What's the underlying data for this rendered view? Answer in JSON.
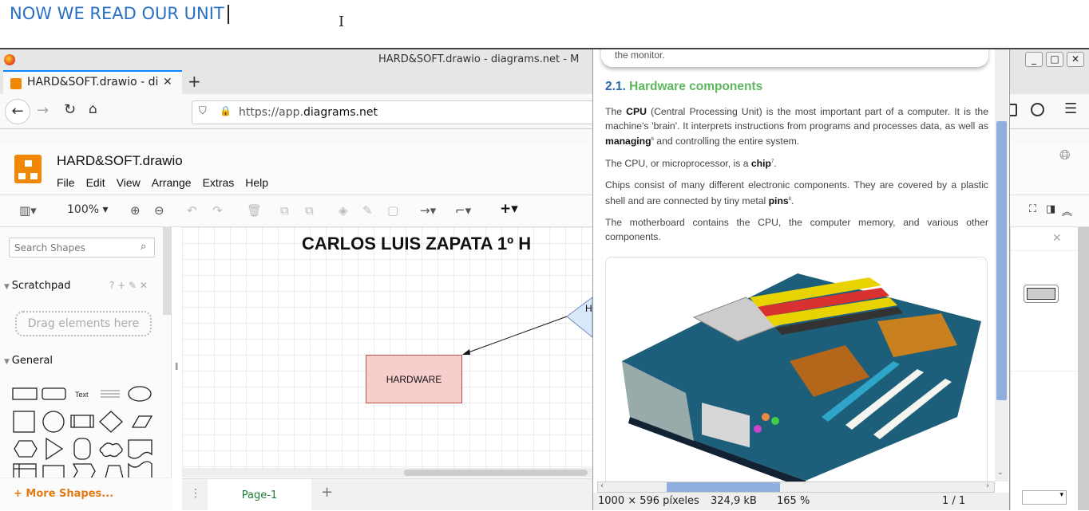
{
  "editor_overlay": {
    "text": "NOW WE READ OUR UNIT"
  },
  "browser": {
    "window_title": "HARD&SOFT.drawio - diagrams.net - M",
    "tab_label": "HARD&SOFT.drawio - di",
    "url_prefix": "https://app.",
    "url_domain": "diagrams.net"
  },
  "drawio": {
    "file_title": "HARD&SOFT.drawio",
    "menu": [
      "File",
      "Edit",
      "View",
      "Arrange",
      "Extras",
      "Help"
    ],
    "zoom": "100%",
    "search_placeholder": "Search Shapes",
    "scratchpad": "Scratchpad",
    "scratchpad_tools": "? + ✎ ✕",
    "drag_hint": "Drag elements here",
    "general": "General",
    "shape_text": "Text",
    "more_shapes": "+ More Shapes...",
    "canvas_title": "CARLOS LUIS ZAPATA 1º H",
    "hardware_box": "HARDWARE",
    "diamond_partial": "H",
    "page_tab": "Page-1"
  },
  "viewer": {
    "top_fragment": "the monitor.",
    "heading_num": "2.1.",
    "heading": "Hardware components",
    "p1_a": "The ",
    "p1_b": "CPU",
    "p1_c": " (Central Processing Unit) is the most important part of a computer. It is the machine's 'brain'. It interprets instructions from programs and processes data, as well as ",
    "p1_d": "managing",
    "p1_e": "6",
    "p1_f": " and controlling the entire system.",
    "p2_a": "The CPU, or microprocessor, is a ",
    "p2_b": "chip",
    "p2_c": "7",
    "p2_d": ".",
    "p3_a": "Chips consist of many different electronic components. They are covered by a plastic shell and are connected by tiny metal ",
    "p3_b": "pins",
    "p3_c": "8",
    "p3_d": ".",
    "p4": "The motherboard contains the CPU, the computer memory, and various other components.",
    "status_dims": "1000 × 596 píxeles",
    "status_size": "324,9 kB",
    "status_zoom": "165 %",
    "status_page": "1 / 1"
  }
}
